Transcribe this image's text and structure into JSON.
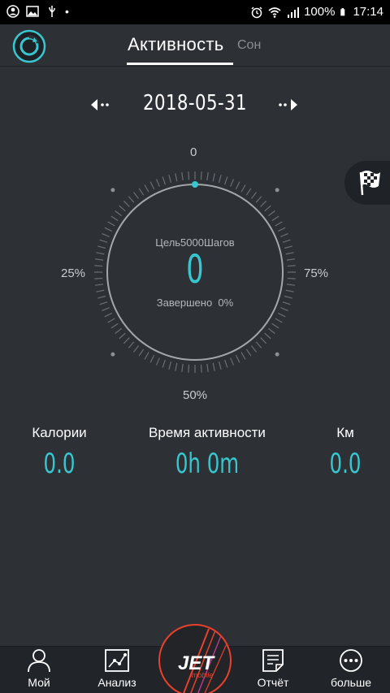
{
  "status_bar": {
    "battery": "100%",
    "time": "17:14",
    "dot": "•"
  },
  "header": {
    "tab_active": "Активность",
    "tab_inactive": "Сон",
    "logo_icon": "refresh-ring-icon"
  },
  "date_nav": {
    "date": "2018-05-31"
  },
  "dial": {
    "label_top": "0",
    "label_left": "25%",
    "label_right": "75%",
    "label_bottom": "50%",
    "goal_text": "Цель5000Шагов",
    "steps": "0",
    "completed_label": "Завершено",
    "completed_value": "0%",
    "progress": 0
  },
  "stats": {
    "calories_label": "Калории",
    "calories_value": "0.0",
    "activity_time_label": "Время активности",
    "activity_time_value": "0h 0m",
    "km_label": "Км",
    "km_value": "0.0"
  },
  "bottom_nav": {
    "items": [
      {
        "label": "Мой",
        "icon": "person-icon"
      },
      {
        "label": "Анализ",
        "icon": "chart-icon"
      },
      {
        "label": "Отчёт",
        "icon": "report-icon"
      },
      {
        "label": "больше",
        "icon": "more-icon"
      }
    ],
    "center_logo_text": "JET",
    "center_logo_subtext": "mobile"
  },
  "colors": {
    "background": "#2d3136",
    "accent": "#38c6cf",
    "brand_red": "#e8412c"
  }
}
